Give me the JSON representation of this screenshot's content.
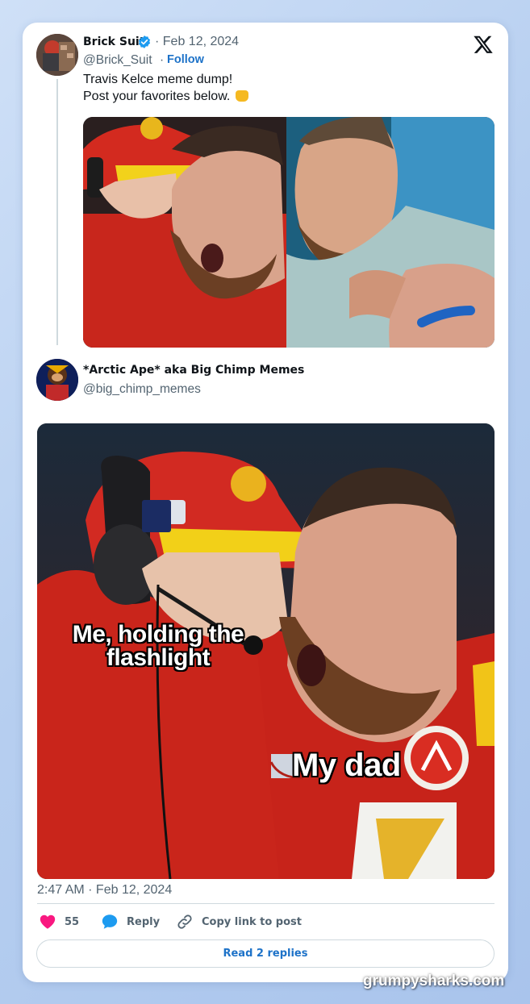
{
  "colors": {
    "accent": "#1d72c8",
    "like": "#f91880",
    "text": "#0f1419",
    "muted": "#536471"
  },
  "tweet": {
    "author_name": "Brick Suit",
    "verified": true,
    "date": "· Feb 12, 2024",
    "handle": "@Brick_Suit",
    "separator": "·",
    "follow_label": "Follow",
    "text_line1": "Travis Kelce meme dump!",
    "text_line2": "Post your favorites below.",
    "emoji_icon": "oncoming-fist-icon"
  },
  "reply": {
    "author_name": "*Arctic Ape* aka Big Chimp Memes",
    "handle": "@big_chimp_memes",
    "meme_caption_1_line1": "Me, holding the",
    "meme_caption_1_line2": "flashlight",
    "meme_caption_2": "My dad"
  },
  "footer": {
    "timestamp": "2:47 AM · Feb 12, 2024",
    "like_count": "55",
    "reply_label": "Reply",
    "copy_link_label": "Copy link to post",
    "read_replies_label": "Read 2 replies"
  },
  "watermark": "grumpysharks.com",
  "icons": [
    "x-logo-icon",
    "verified-badge-icon",
    "heart-icon",
    "reply-bubble-icon",
    "link-icon"
  ]
}
